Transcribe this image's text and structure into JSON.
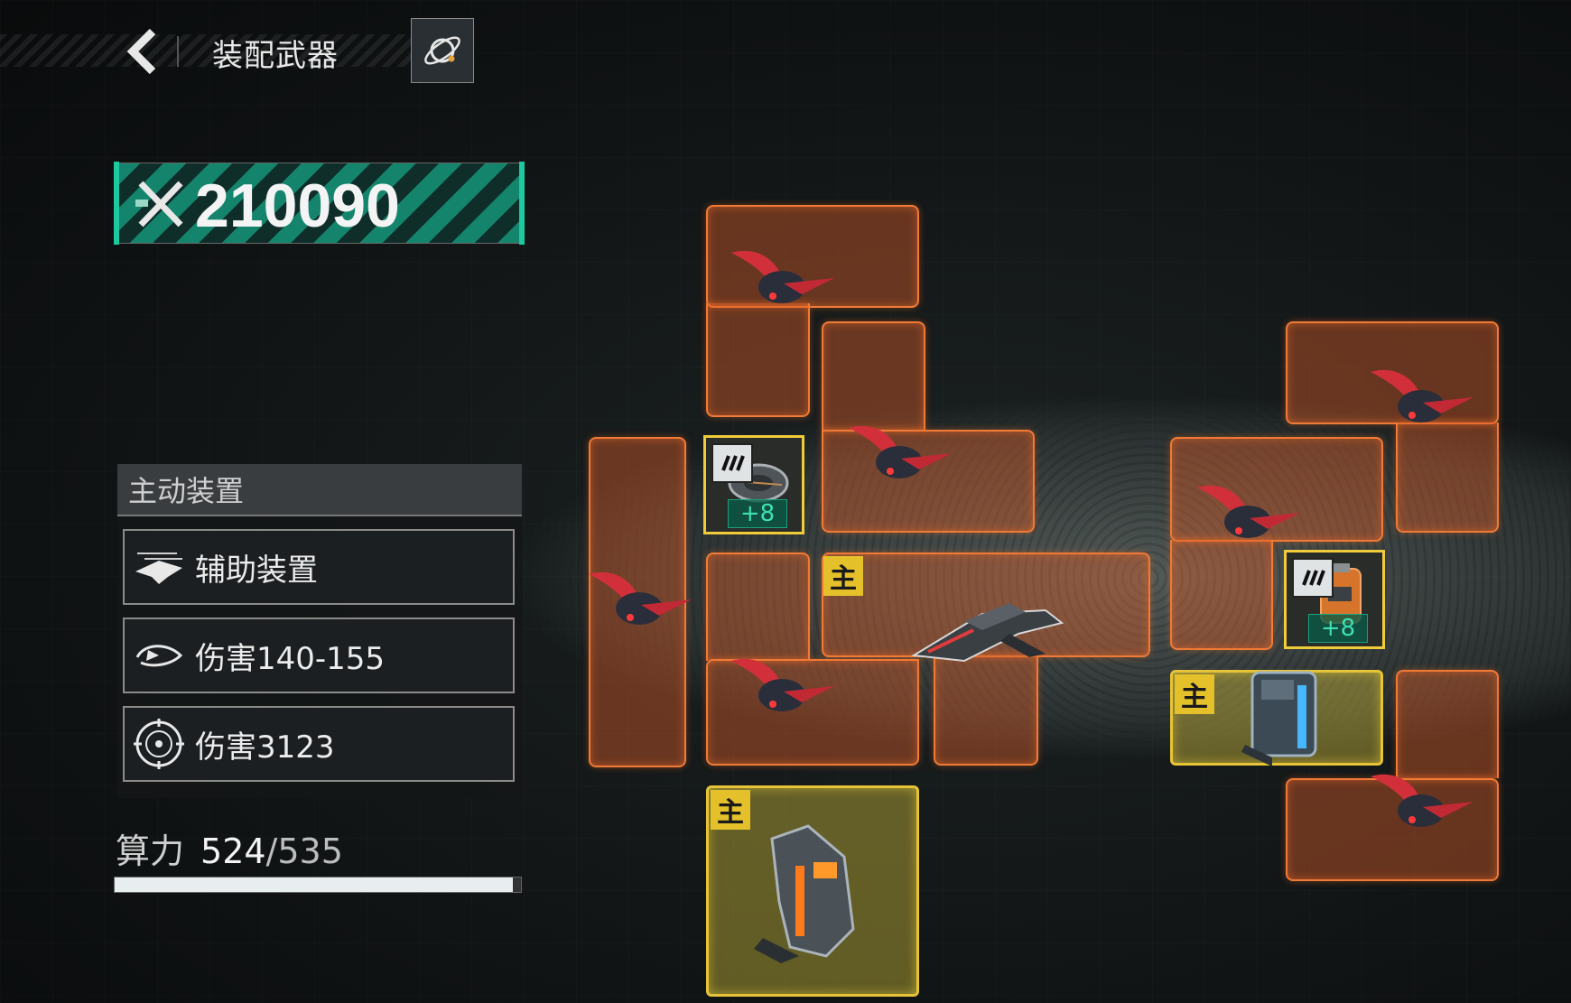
{
  "header": {
    "title": "装配武器"
  },
  "power": {
    "value": "210090"
  },
  "active_device": {
    "section_title": "主动装置",
    "rows": [
      {
        "label": "辅助装置",
        "icon": "aux-device-icon"
      },
      {
        "label": "伤害140-155",
        "icon": "swirl-damage-icon"
      },
      {
        "label": "伤害3123",
        "icon": "target-damage-icon"
      }
    ]
  },
  "compute": {
    "label": "算力",
    "used": "524",
    "separator": "/",
    "total": "535",
    "fill_fraction": 0.979
  },
  "board": {
    "main_tag": "主",
    "module_level_1": "+8",
    "module_level_2": "+8"
  },
  "colors": {
    "slot_orange": "#f07a36",
    "slot_main_yellow": "#e7c437",
    "power_accent": "#1ec9a0"
  }
}
